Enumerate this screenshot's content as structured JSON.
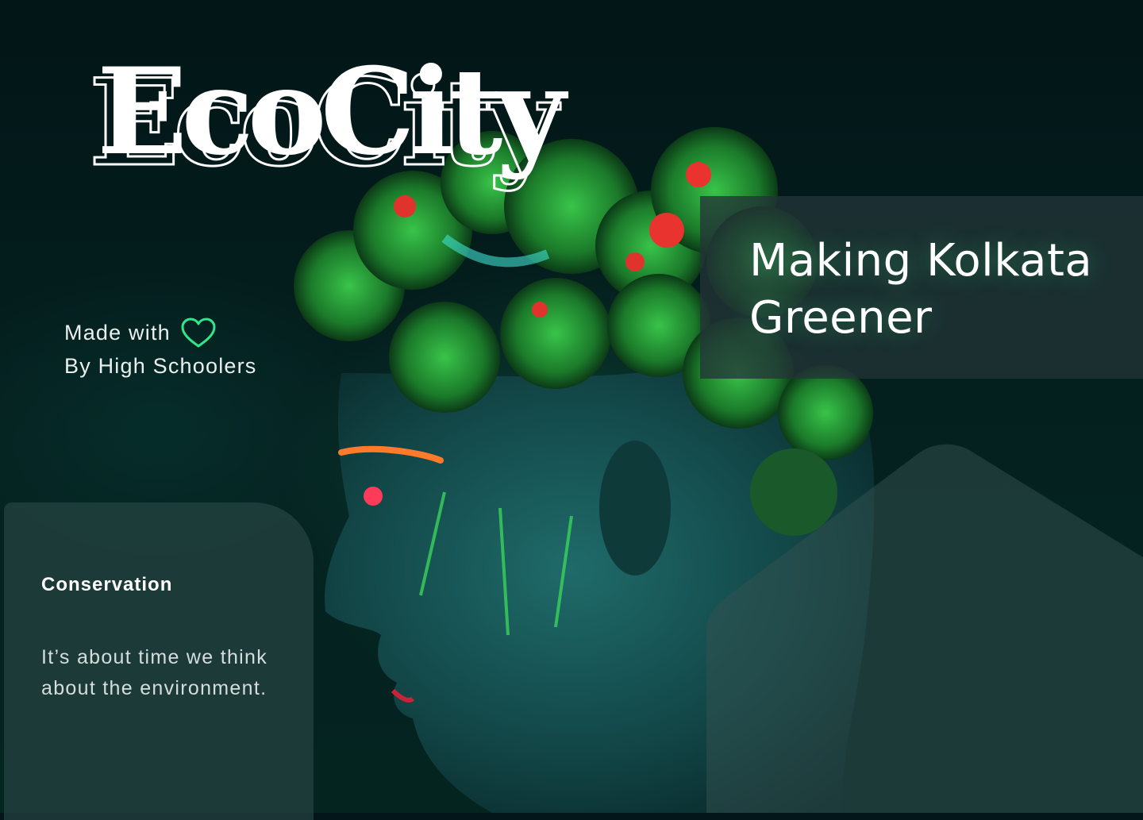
{
  "brand": {
    "title": "EcoCity"
  },
  "made_with": {
    "line1": "Made with",
    "line2": "By High Schoolers",
    "heart_icon": "heart-icon"
  },
  "tagline": {
    "line1": "Making Kolkata",
    "line2": "Greener"
  },
  "conservation": {
    "heading": "Conservation",
    "text": "It’s about time we think about the environment."
  },
  "colors": {
    "background": "#03171a",
    "accent_green": "#2ee88a",
    "panel": "#223437"
  }
}
